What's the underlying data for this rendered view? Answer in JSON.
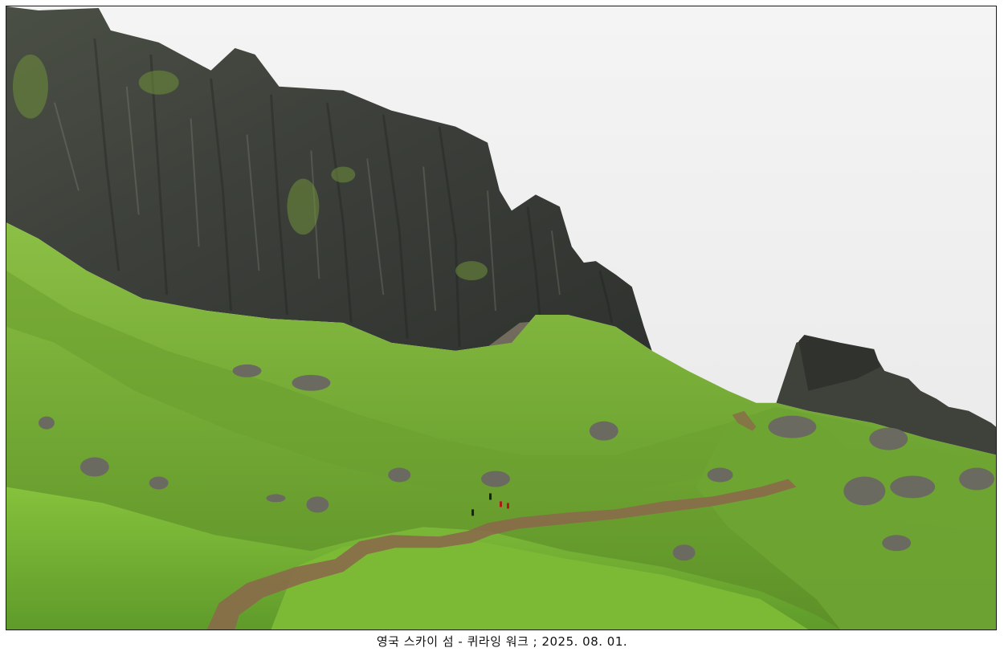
{
  "photo": {
    "subject": "landscape-photo"
  },
  "caption": {
    "text": "영국 스카이 섬 - 퀴라잉 워크 ; 2025. 08. 01."
  },
  "colors": {
    "sky": "#ececec",
    "cliff_dark": "#3a3d38",
    "cliff_mid": "#55584f",
    "grass_bright": "#7fb63a",
    "grass_mid": "#6a9c30",
    "grass_dark": "#4d7a25",
    "path": "#8a6a4a",
    "frame": "#1a1a1a"
  }
}
